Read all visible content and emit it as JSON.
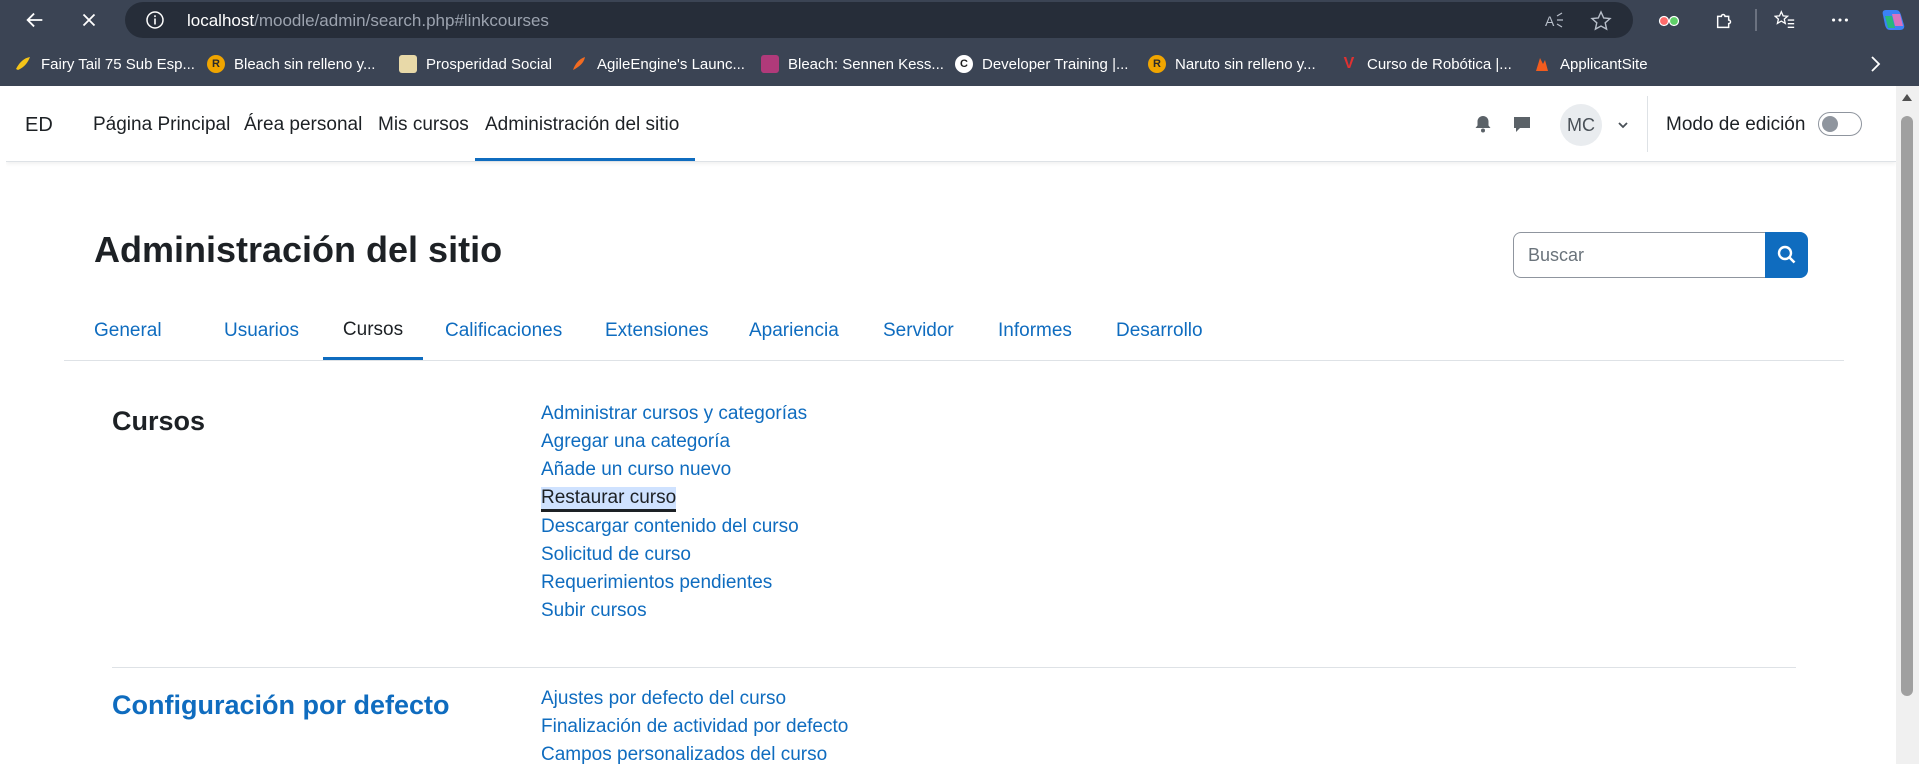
{
  "browser": {
    "url_host": "localhost",
    "url_path": "/moodle/admin/search.php#linkcourses",
    "bookmarks": [
      {
        "label": "Fairy Tail 75 Sub Esp...",
        "icon": "wing-icon",
        "color": "#f5c518"
      },
      {
        "label": "Bleach sin relleno y...",
        "icon": "letter-r-icon",
        "color": "#f0a500"
      },
      {
        "label": "Prosperidad Social",
        "icon": "shield-icon",
        "color": "#e8d9a8"
      },
      {
        "label": "AgileEngine's Launc...",
        "icon": "rocket-icon",
        "color": "#f26b21"
      },
      {
        "label": "Bleach: Sennen Kess...",
        "icon": "anime-icon",
        "color": "#b03a7a"
      },
      {
        "label": "Developer Training |...",
        "icon": "letter-c-icon",
        "color": "#1e1e1e"
      },
      {
        "label": "Naruto sin relleno y...",
        "icon": "letter-r-icon",
        "color": "#f0a500"
      },
      {
        "label": "Curso de Robótica |...",
        "icon": "v-icon",
        "color": "#e03131"
      },
      {
        "label": "ApplicantSite",
        "icon": "flame-icon",
        "color": "#f25c1e"
      }
    ]
  },
  "navbar": {
    "brand": "ED",
    "links": [
      "Página Principal",
      "Área personal",
      "Mis cursos",
      "Administración del sitio"
    ],
    "avatar_initials": "MC",
    "edit_mode_label": "Modo de edición",
    "edit_mode_on": false
  },
  "header": {
    "title": "Administración del sitio",
    "search_placeholder": "Buscar"
  },
  "tabs": [
    "General",
    "Usuarios",
    "Cursos",
    "Calificaciones",
    "Extensiones",
    "Apariencia",
    "Servidor",
    "Informes",
    "Desarrollo"
  ],
  "active_tab": "Cursos",
  "sections": [
    {
      "title": "Cursos",
      "links": [
        "Administrar cursos y categorías",
        "Agregar una categoría",
        "Añade un curso nuevo",
        "Restaurar curso",
        "Descargar contenido del curso",
        "Solicitud de curso",
        "Requerimientos pendientes",
        "Subir cursos"
      ]
    },
    {
      "title": "Configuración por defecto",
      "links": [
        "Ajustes por defecto del curso",
        "Finalización de actividad por defecto",
        "Campos personalizados del curso"
      ]
    }
  ],
  "focused_link": "Restaurar curso",
  "colors": {
    "accent": "#0f6cbf",
    "chrome": "#3b4454",
    "text": "#1d2125"
  }
}
